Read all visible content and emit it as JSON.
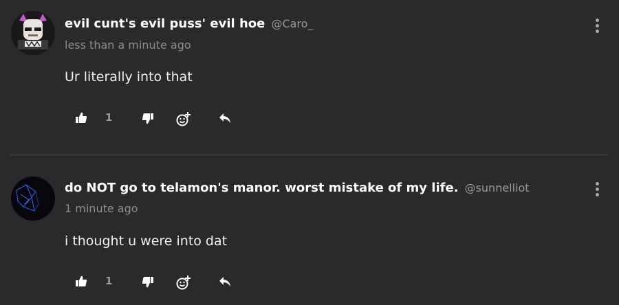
{
  "posts": [
    {
      "display_name": "evil cunt's evil puss' evil hoe",
      "handle": "@Caro_",
      "timestamp": "less than a minute ago",
      "body": "Ur literally into that",
      "like_count": "1"
    },
    {
      "display_name": "do NOT go to telamon's manor. worst mistake of my life.",
      "handle": "@sunnelliot",
      "timestamp": "1 minute ago",
      "body": "i thought u were into dat",
      "like_count": "1"
    }
  ],
  "icons": {
    "like": "thumbs-up-icon",
    "dislike": "thumbs-down-icon",
    "react": "add-reaction-icon",
    "reply": "reply-icon",
    "more": "more-vertical-icon"
  },
  "colors": {
    "background": "#2b292b",
    "text": "#ffffff",
    "muted": "#8f8d8f",
    "divider": "#4a484a"
  }
}
